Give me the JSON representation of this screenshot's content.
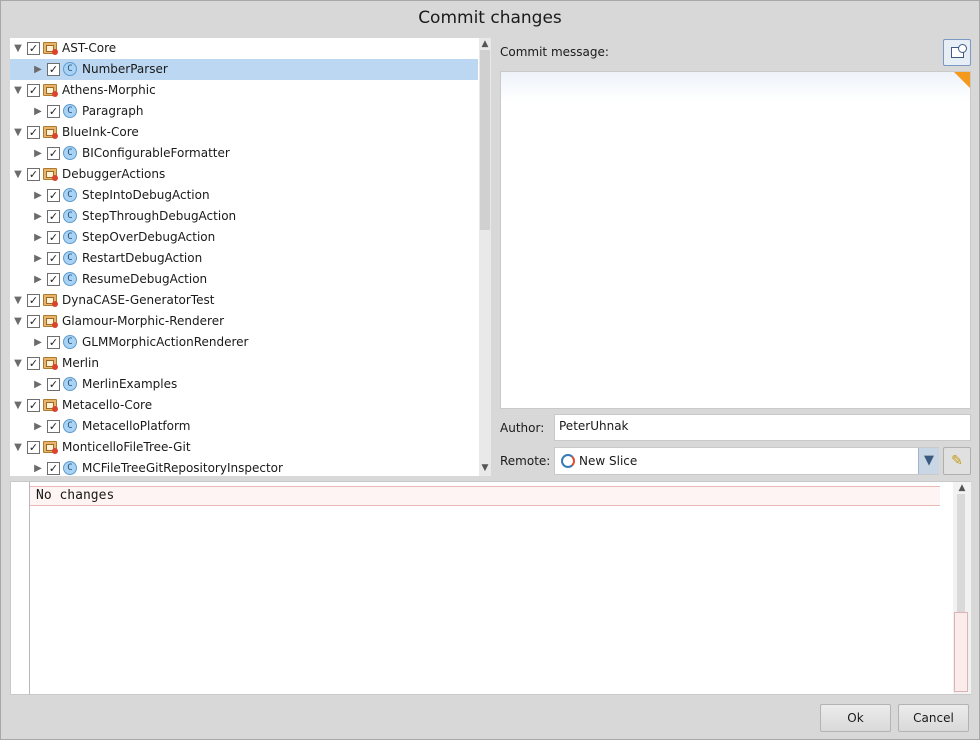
{
  "window": {
    "title": "Commit changes"
  },
  "tree": {
    "rows": [
      {
        "type": "package",
        "label": "AST-Core",
        "expanded": true,
        "checked": true,
        "selected": false
      },
      {
        "type": "class",
        "label": "NumberParser",
        "expanded": false,
        "checked": true,
        "selected": true
      },
      {
        "type": "package",
        "label": "Athens-Morphic",
        "expanded": true,
        "checked": true,
        "selected": false
      },
      {
        "type": "class",
        "label": "Paragraph",
        "expanded": false,
        "checked": true,
        "selected": false
      },
      {
        "type": "package",
        "label": "BlueInk-Core",
        "expanded": true,
        "checked": true,
        "selected": false
      },
      {
        "type": "class",
        "label": "BIConfigurableFormatter",
        "expanded": false,
        "checked": true,
        "selected": false
      },
      {
        "type": "package",
        "label": "DebuggerActions",
        "expanded": true,
        "checked": true,
        "selected": false
      },
      {
        "type": "class",
        "label": "StepIntoDebugAction",
        "expanded": false,
        "checked": true,
        "selected": false
      },
      {
        "type": "class",
        "label": "StepThroughDebugAction",
        "expanded": false,
        "checked": true,
        "selected": false
      },
      {
        "type": "class",
        "label": "StepOverDebugAction",
        "expanded": false,
        "checked": true,
        "selected": false
      },
      {
        "type": "class",
        "label": "RestartDebugAction",
        "expanded": false,
        "checked": true,
        "selected": false
      },
      {
        "type": "class",
        "label": "ResumeDebugAction",
        "expanded": false,
        "checked": true,
        "selected": false
      },
      {
        "type": "package",
        "label": "DynaCASE-GeneratorTest",
        "expanded": true,
        "checked": true,
        "selected": false
      },
      {
        "type": "package",
        "label": "Glamour-Morphic-Renderer",
        "expanded": true,
        "checked": true,
        "selected": false
      },
      {
        "type": "class",
        "label": "GLMMorphicActionRenderer",
        "expanded": false,
        "checked": true,
        "selected": false
      },
      {
        "type": "package",
        "label": "Merlin",
        "expanded": true,
        "checked": true,
        "selected": false
      },
      {
        "type": "class",
        "label": "MerlinExamples",
        "expanded": false,
        "checked": true,
        "selected": false
      },
      {
        "type": "package",
        "label": "Metacello-Core",
        "expanded": true,
        "checked": true,
        "selected": false
      },
      {
        "type": "class",
        "label": "MetacelloPlatform",
        "expanded": false,
        "checked": true,
        "selected": false
      },
      {
        "type": "package",
        "label": "MonticelloFileTree-Git",
        "expanded": true,
        "checked": true,
        "selected": false
      },
      {
        "type": "class",
        "label": "MCFileTreeGitRepositoryInspector",
        "expanded": false,
        "checked": true,
        "selected": false
      }
    ]
  },
  "commit": {
    "message_label": "Commit message:",
    "message_value": "",
    "history_icon": "history-icon"
  },
  "author": {
    "label": "Author:",
    "value": "PeterUhnak"
  },
  "remote": {
    "label": "Remote:",
    "value": "New Slice",
    "icon": "repository-icon"
  },
  "diff": {
    "text": "No changes"
  },
  "buttons": {
    "ok": "Ok",
    "cancel": "Cancel"
  }
}
